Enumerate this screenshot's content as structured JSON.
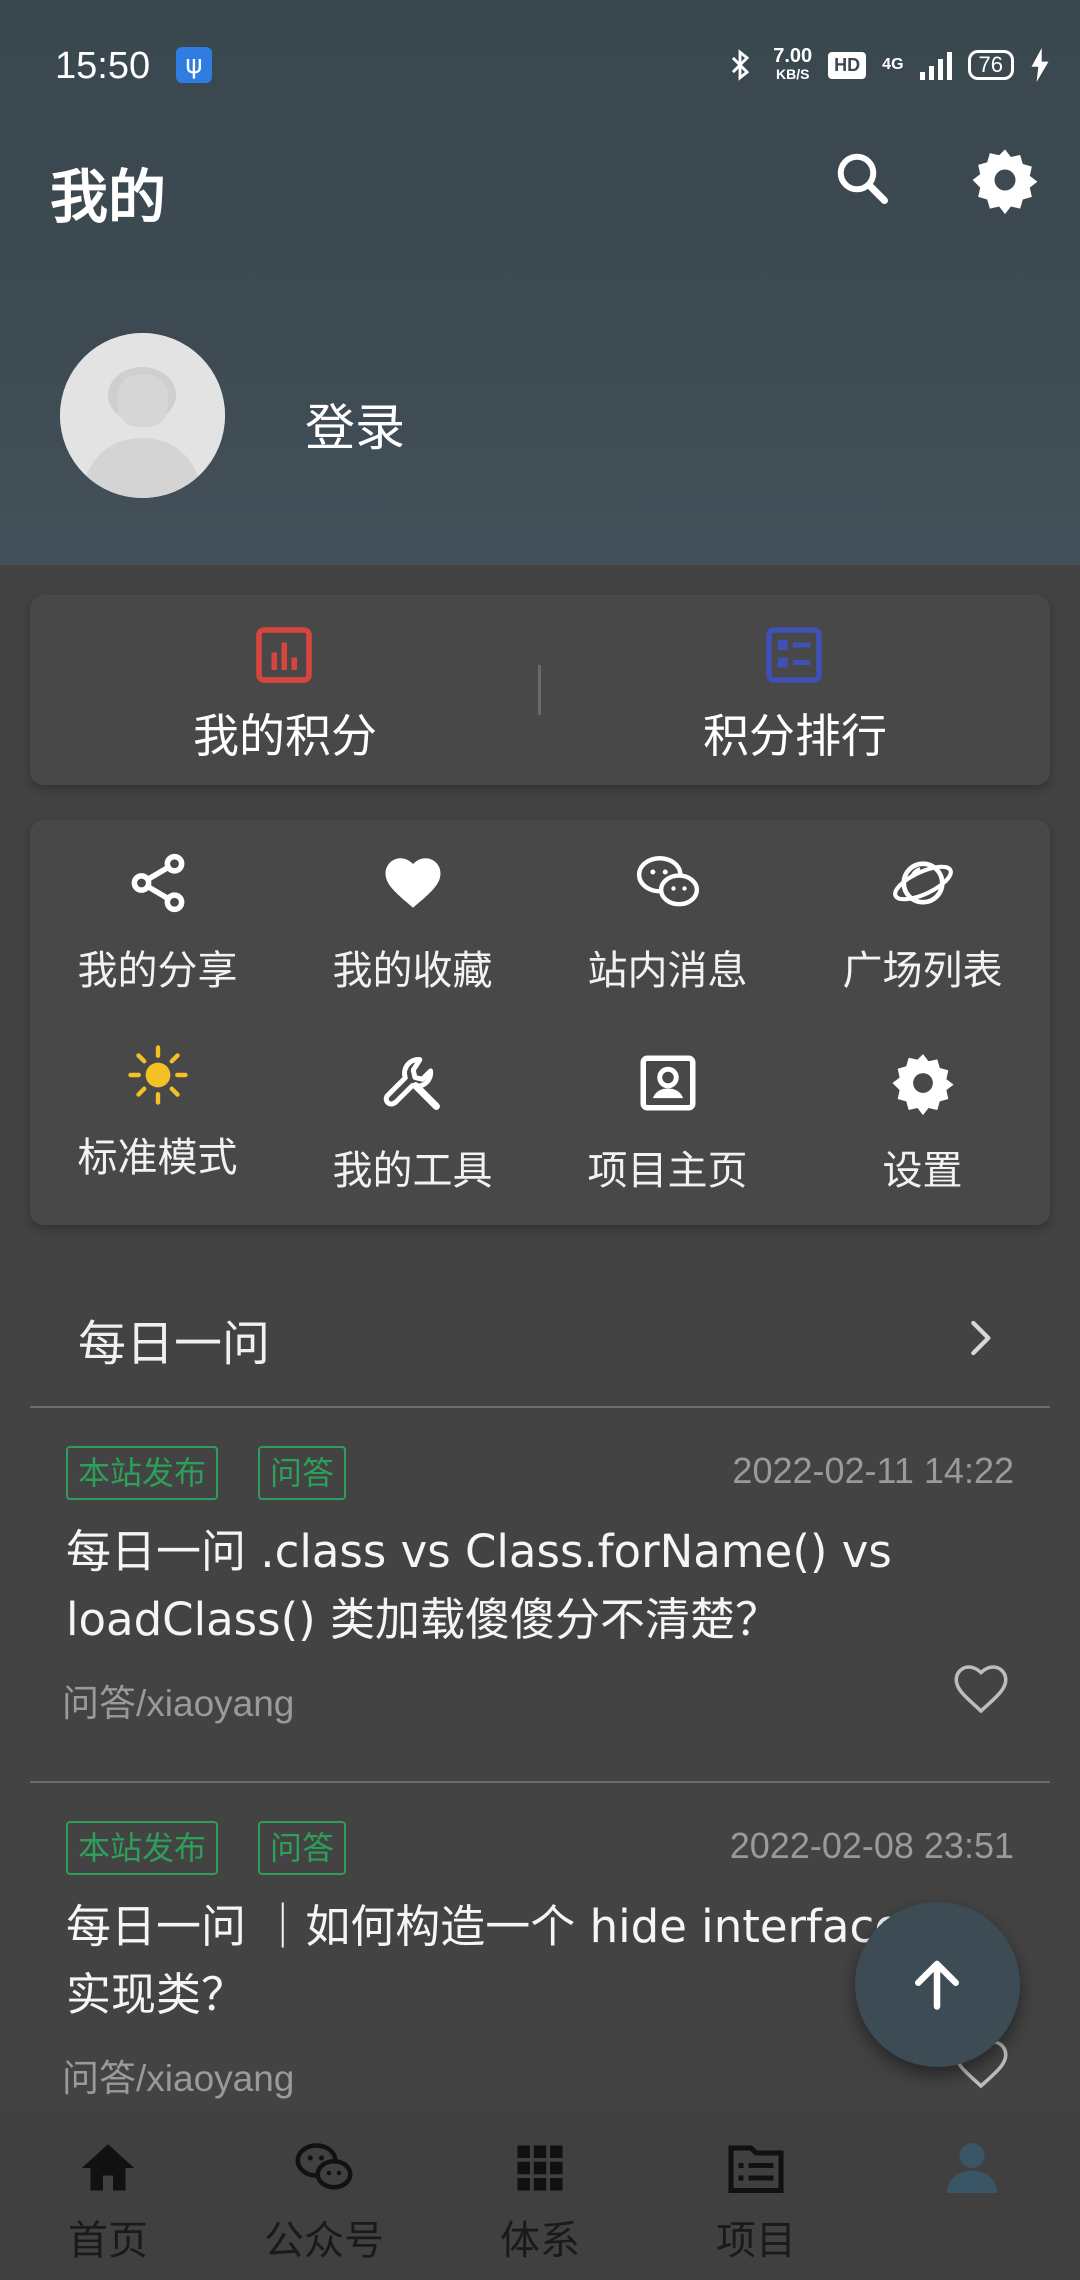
{
  "status_bar": {
    "time": "15:50",
    "speed_value": "7.00",
    "speed_unit": "KB/S",
    "hd": "HD",
    "network": "4G",
    "battery": "76"
  },
  "app_bar": {
    "title": "我的"
  },
  "profile": {
    "login_label": "登录"
  },
  "points": {
    "my_points": "我的积分",
    "ranking": "积分排行"
  },
  "grid": {
    "items": [
      {
        "label": "我的分享",
        "icon": "share-icon"
      },
      {
        "label": "我的收藏",
        "icon": "heart-icon"
      },
      {
        "label": "站内消息",
        "icon": "wechat-icon"
      },
      {
        "label": "广场列表",
        "icon": "planet-icon"
      },
      {
        "label": "标准模式",
        "icon": "sun-icon"
      },
      {
        "label": "我的工具",
        "icon": "wrench-icon"
      },
      {
        "label": "项目主页",
        "icon": "contact-card-icon"
      },
      {
        "label": "设置",
        "icon": "gear-icon"
      }
    ]
  },
  "daily": {
    "title": "每日一问"
  },
  "articles": [
    {
      "tags": [
        "本站发布",
        "问答"
      ],
      "date": "2022-02-11 14:22",
      "title": "每日一问 .class vs Class.forName() vs loadClass() 类加载傻傻分不清楚？",
      "author": "问答/xiaoyang"
    },
    {
      "tags": [
        "本站发布",
        "问答"
      ],
      "date": "2022-02-08 23:51",
      "title": "每日一问 ｜如何构造一个 hide interface 的实现类？",
      "author": "问答/xiaoyang"
    }
  ],
  "bottom_nav": {
    "items": [
      {
        "label": "首页",
        "icon": "home-icon"
      },
      {
        "label": "公众号",
        "icon": "wechat-icon"
      },
      {
        "label": "体系",
        "icon": "grid-icon"
      },
      {
        "label": "项目",
        "icon": "folder-icon"
      },
      {
        "label": "",
        "icon": "person-icon"
      }
    ]
  },
  "colors": {
    "header_bg": "#3d4a52",
    "body_bg": "#434343",
    "tag_green": "#2e9e5b",
    "points_red": "#d9453d",
    "ranking_blue": "#3f51b5",
    "sun_yellow": "#f5c024",
    "nav_active": "#3a5566"
  }
}
